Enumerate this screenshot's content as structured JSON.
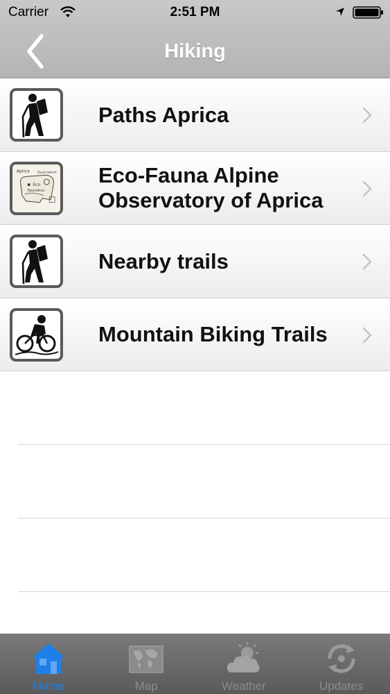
{
  "status_bar": {
    "carrier": "Carrier",
    "time": "2:51 PM",
    "icons": [
      "wifi-icon",
      "location-arrow-icon",
      "battery-icon"
    ]
  },
  "nav": {
    "title": "Hiking",
    "back_icon": "chevron-left-icon"
  },
  "list": {
    "items": [
      {
        "label": "Paths Aprica",
        "icon": "hiker-icon"
      },
      {
        "label": "Eco-Fauna Alpine Observatory of Aprica",
        "icon": "bear-map-icon"
      },
      {
        "label": "Nearby trails",
        "icon": "hiker-icon"
      },
      {
        "label": "Mountain Biking Trails",
        "icon": "mountain-bike-icon"
      }
    ],
    "bear_map_text": {
      "line1": "Aprica",
      "line2": "Osservatorio",
      "line3": "Eco",
      "line4": "Faunistico"
    }
  },
  "tabbar": {
    "tabs": [
      {
        "label": "Home",
        "icon": "home-icon",
        "active": true
      },
      {
        "label": "Map",
        "icon": "world-map-icon",
        "active": false
      },
      {
        "label": "Weather",
        "icon": "weather-icon",
        "active": false
      },
      {
        "label": "Updates",
        "icon": "refresh-icon",
        "active": false
      }
    ]
  },
  "colors": {
    "nav_bar": "#bdbdbd",
    "tab_bar": "#666666",
    "active_tab": "#1f7fe8",
    "inactive_tab": "#8c8c8c"
  }
}
